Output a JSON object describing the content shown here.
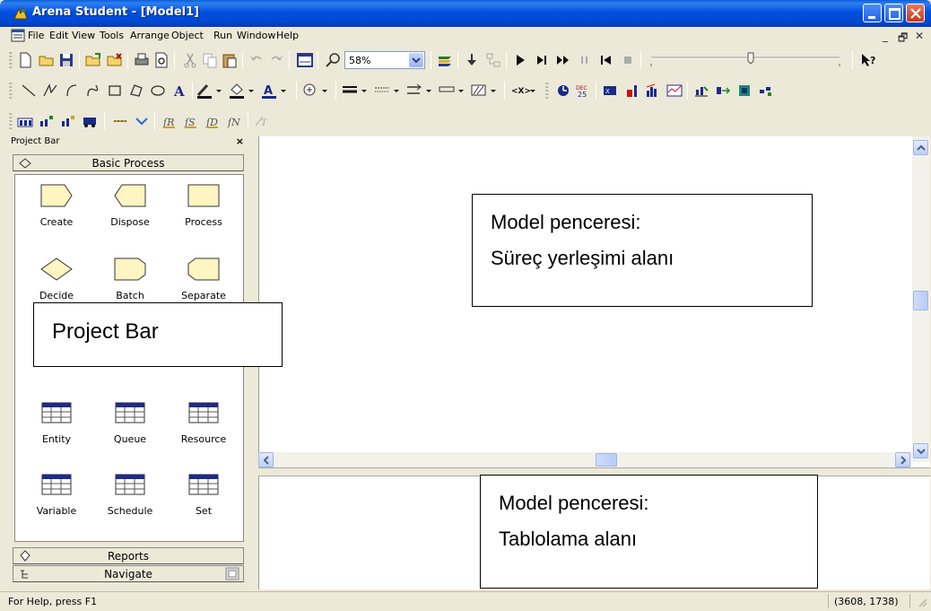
{
  "window": {
    "title": "Arena Student - [Model1]",
    "icon": "arena-app-icon",
    "controls": [
      "minimize",
      "maximize",
      "close"
    ]
  },
  "menu": {
    "items": [
      "File",
      "Edit",
      "View",
      "Tools",
      "Arrange",
      "Object",
      "Run",
      "Window",
      "Help"
    ],
    "mdi_controls": [
      "_",
      "🗗",
      "✕"
    ]
  },
  "toolbar": {
    "zoom_value": "58%"
  },
  "project_bar": {
    "title": "Project Bar",
    "close": "×",
    "basic_process_header": "Basic Process",
    "modules": [
      {
        "label": "Create",
        "shape": "create"
      },
      {
        "label": "Dispose",
        "shape": "dispose"
      },
      {
        "label": "Process",
        "shape": "process"
      },
      {
        "label": "Decide",
        "shape": "decide"
      },
      {
        "label": "Batch",
        "shape": "batch"
      },
      {
        "label": "Separate",
        "shape": "separate"
      },
      {
        "label": "Entity",
        "shape": "table"
      },
      {
        "label": "Queue",
        "shape": "table"
      },
      {
        "label": "Resource",
        "shape": "table"
      },
      {
        "label": "Variable",
        "shape": "table"
      },
      {
        "label": "Schedule",
        "shape": "table"
      },
      {
        "label": "Set",
        "shape": "table"
      }
    ],
    "reports_header": "Reports",
    "navigate_header": "Navigate"
  },
  "annotations": {
    "project_bar": "Project Bar",
    "model_window_top": [
      "Model penceresi:",
      "Süreç yerleşimi alanı"
    ],
    "model_window_bottom": [
      "Model penceresi:",
      "Tablolama alanı"
    ]
  },
  "statusbar": {
    "help_text": "For Help, press F1",
    "coordinates": "(3608, 1738)"
  },
  "colors": {
    "titlebar": "#0054e3",
    "module_fill": "#fff5c2",
    "table_header": "#1f2a8a"
  }
}
